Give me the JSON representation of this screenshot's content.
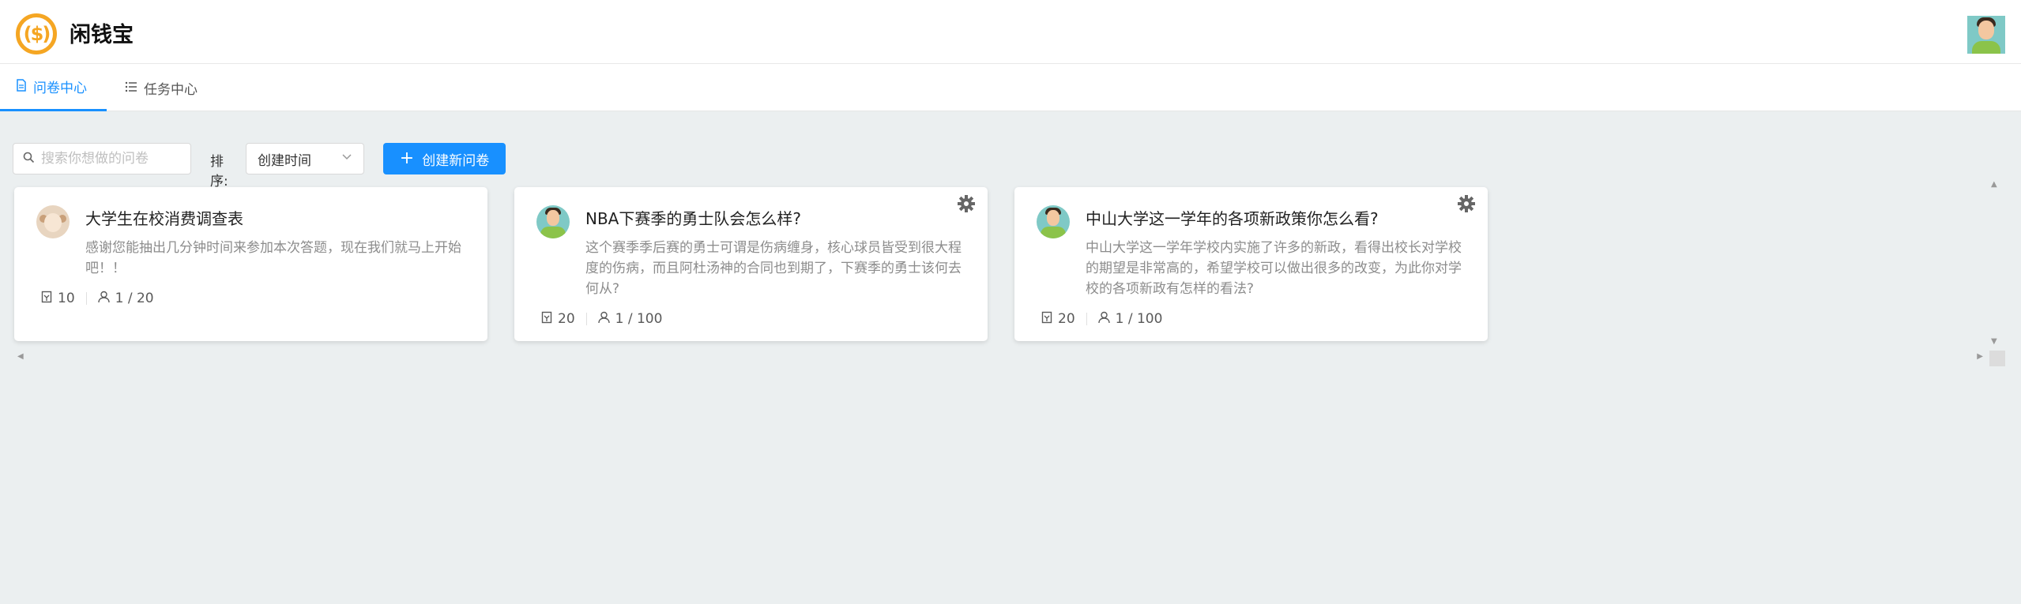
{
  "app": {
    "name": "闲钱宝",
    "logo_symbol": "($)"
  },
  "tabs": [
    {
      "label": "问卷中心",
      "icon": "document-icon",
      "active": true
    },
    {
      "label": "任务中心",
      "icon": "list-icon",
      "active": false
    }
  ],
  "toolbar": {
    "search_placeholder": "搜索你想做的问卷",
    "sort_label": "排序:",
    "sort_value": "创建时间",
    "create_label": "创建新问卷"
  },
  "cards": [
    {
      "title": "大学生在校消费调查表",
      "desc": "感谢您能抽出几分钟时间来参加本次答题，现在我们就马上开始吧！！",
      "reward": "10",
      "participants": "1 / 20",
      "avatar": "monkey-avatar",
      "has_settings": false
    },
    {
      "title": "NBA下赛季的勇士队会怎么样?",
      "desc": "这个赛季季后赛的勇士可谓是伤病缠身，核心球员皆受到很大程度的伤病，而且阿杜汤神的合同也到期了，下赛季的勇士该何去何从?",
      "reward": "20",
      "participants": "1 / 100",
      "avatar": "man-avatar",
      "has_settings": true
    },
    {
      "title": "中山大学这一学年的各项新政策你怎么看?",
      "desc": "中山大学这一学年学校内实施了许多的新政，看得出校长对学校的期望是非常高的，希望学校可以做出很多的改变，为此你对学校的各项新政有怎样的看法?",
      "reward": "20",
      "participants": "1 / 100",
      "avatar": "man-avatar",
      "has_settings": true
    }
  ],
  "colors": {
    "primary": "#1890ff",
    "logo": "#f5a623",
    "background": "#ebeff0"
  }
}
